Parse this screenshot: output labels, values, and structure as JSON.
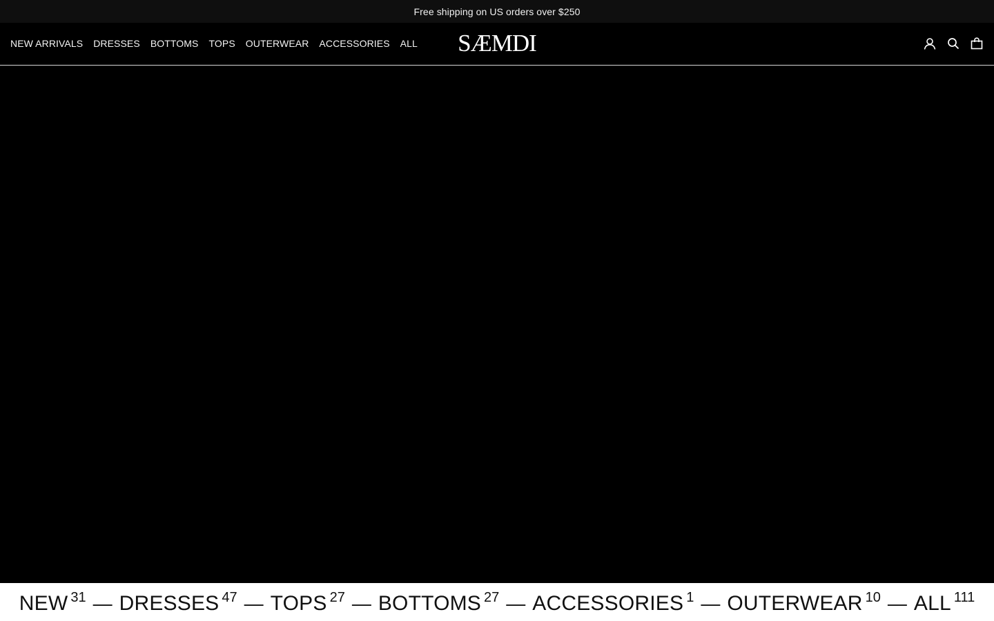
{
  "announcement": {
    "text": "Free shipping on US orders over $250"
  },
  "header": {
    "nav": [
      {
        "label": "NEW ARRIVALS"
      },
      {
        "label": "DRESSES"
      },
      {
        "label": "BOTTOMS"
      },
      {
        "label": "TOPS"
      },
      {
        "label": "OUTERWEAR"
      },
      {
        "label": "ACCESSORIES"
      },
      {
        "label": "ALL"
      }
    ],
    "logo_text": "SÆMDI",
    "icons": [
      "account-icon",
      "search-icon",
      "cart-icon"
    ]
  },
  "hero": {
    "background": "#000000"
  },
  "categories": [
    {
      "name": "NEW",
      "count": "31"
    },
    {
      "name": "DRESSES",
      "count": "47"
    },
    {
      "name": "TOPS",
      "count": "27"
    },
    {
      "name": "BOTTOMS",
      "count": "27"
    },
    {
      "name": "ACCESSORIES",
      "count": "1"
    },
    {
      "name": "OUTERWEAR",
      "count": "10"
    },
    {
      "name": "ALL",
      "count": "111"
    }
  ],
  "separator": "—",
  "colors": {
    "announcement_bg": "#0f0f0f",
    "header_bg": "#000000",
    "category_bar_bg": "#ffffff",
    "text_light": "#f4f4f4",
    "text_dark": "#111111"
  }
}
